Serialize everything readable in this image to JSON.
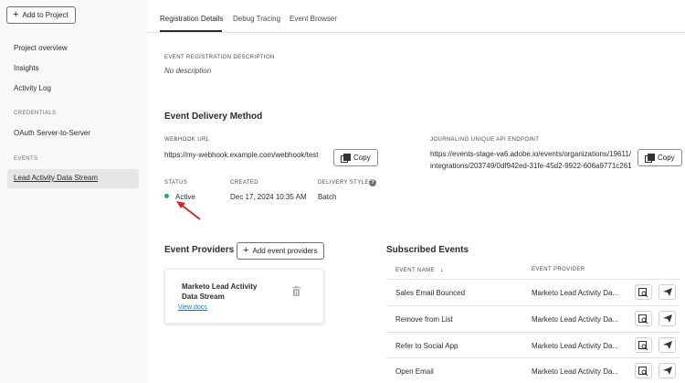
{
  "sidebar": {
    "add_project": "Add to Project",
    "items": [
      {
        "label": "Project overview"
      },
      {
        "label": "Insights"
      },
      {
        "label": "Activity Log"
      }
    ],
    "credentials_section": "CREDENTIALS",
    "credentials_item": "OAuth Server-to-Server",
    "events_section": "EVENTS",
    "events_item": "Lead Activity Data Stream"
  },
  "tabs": [
    {
      "label": "Registration Details"
    },
    {
      "label": "Debug Tracing"
    },
    {
      "label": "Event Browser"
    }
  ],
  "description": {
    "label": "EVENT REGISTRATION DESCRIPTION",
    "value": "No description"
  },
  "delivery": {
    "heading": "Event Delivery Method",
    "webhook_label": "WEBHOOK URL",
    "webhook_value": "https://my-webhook.example.com/webhook/test",
    "journaling_label": "JOURNALING UNIQUE API ENDPOINT",
    "journaling_line1": "https://events-stage-va6.adobe.io/events/organizations/19611/",
    "journaling_line2": "integrations/203749/0df942ed-31fe-45d2-9922-606a9771c261",
    "copy_label": "Copy",
    "status_label": "STATUS",
    "status_value": "Active",
    "created_label": "CREATED",
    "created_value": "Dec 17, 2024 10:35 AM",
    "style_label": "DELIVERY STYLE",
    "style_value": "Batch",
    "help_glyph": "?"
  },
  "providers": {
    "heading": "Event Providers",
    "add_label": "Add event providers",
    "card_title": "Marketo Lead Activity Data Stream",
    "card_link": "View docs"
  },
  "subscribed": {
    "heading": "Subscribed Events",
    "col_name": "EVENT NAME",
    "col_provider": "EVENT PROVIDER",
    "rows": [
      {
        "name": "Sales Email Bounced",
        "provider": "Marketo Lead Activity Da..."
      },
      {
        "name": "Remove from List",
        "provider": "Marketo Lead Activity Da..."
      },
      {
        "name": "Refer to Social App",
        "provider": "Marketo Lead Activity Da..."
      },
      {
        "name": "Open Email",
        "provider": "Marketo Lead Activity Da..."
      }
    ]
  },
  "colors": {
    "status_active": "#2d9d78",
    "annotation_arrow": "#e02020",
    "link": "#1473e6"
  }
}
